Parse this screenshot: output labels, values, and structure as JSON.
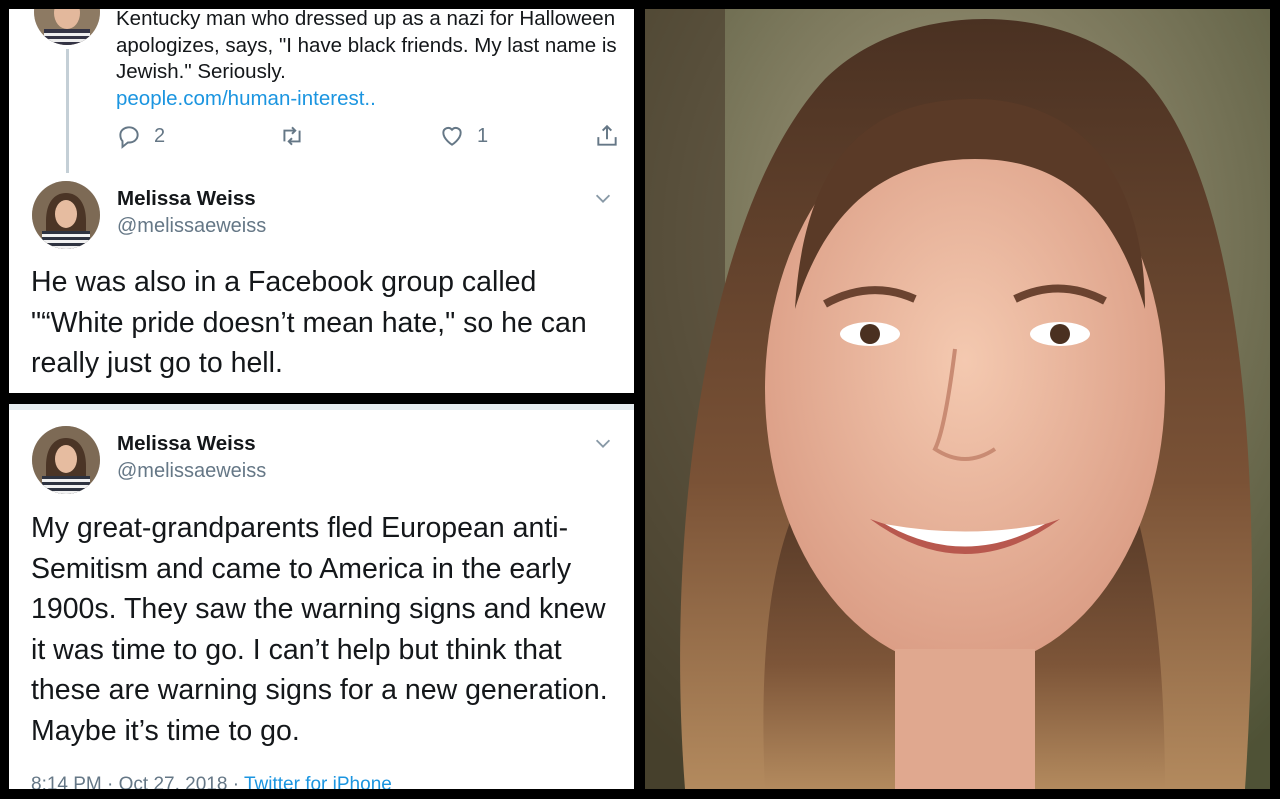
{
  "top_tweet": {
    "quoted_text": "Kentucky man who dressed up as a nazi for Halloween apologizes, says, \"I have black friends. My last name is Jewish.\" Seriously.",
    "link": "people.com/human-interest..",
    "actions": {
      "reply_icon": "reply-icon",
      "reply_count": "2",
      "retweet_icon": "retweet-icon",
      "like_icon": "heart-icon",
      "like_count": "1",
      "share_icon": "share-icon"
    }
  },
  "reply_tweet": {
    "author_name": "Melissa Weiss",
    "author_handle": "@melissaeweiss",
    "text": "He was also in a Facebook group called \"“White pride doesn’t mean hate,\" so he can really just go to hell."
  },
  "second_tweet": {
    "author_name": "Melissa Weiss",
    "author_handle": "@melissaeweiss",
    "text": "My great-grandparents fled European anti-Semitism and came to America in the early 1900s. They saw the warning signs and knew it was time to go. I can’t help but think that these are warning signs for a new generation. Maybe it’s time to go.",
    "timestamp": "8:14 PM · Oct 27, 2018 · ",
    "source": "Twitter for iPhone"
  },
  "colors": {
    "text": "#14171a",
    "secondary": "#657786",
    "link": "#1b95e0",
    "border": "#000000"
  }
}
